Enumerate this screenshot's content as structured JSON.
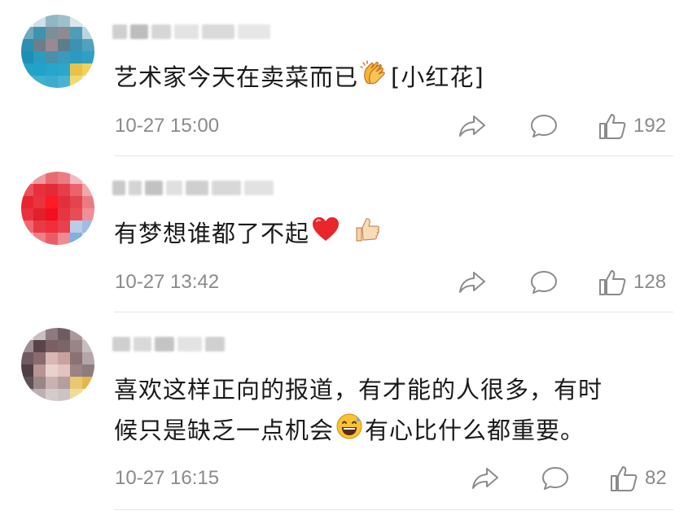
{
  "comments": [
    {
      "text": "艺术家今天在卖菜而已",
      "text_suffix": "[小红花]",
      "time": "10-27 15:00",
      "likes": "192",
      "emojis": [
        "clapping-hands-emoji"
      ]
    },
    {
      "text": "有梦想谁都了不起",
      "time": "10-27 13:42",
      "likes": "128",
      "emojis": [
        "red-heart-emoji",
        "thumbs-up-emoji"
      ]
    },
    {
      "text_line1": "喜欢这样正向的报道，有才能的人很多，有时",
      "text_line2a": "候只是缺乏一点机会",
      "text_line2b": "有心比什么都重要。",
      "time": "10-27 16:15",
      "likes": "82",
      "emojis": [
        "grinning-sweat-emoji"
      ]
    }
  ],
  "icons": {
    "share": "share-icon",
    "comment": "comment-icon",
    "like": "thumbs-up-icon"
  },
  "colors": {
    "meta_gray": "#8a8a8a",
    "divider": "#e6e6e6",
    "text": "#1a1a1a"
  }
}
